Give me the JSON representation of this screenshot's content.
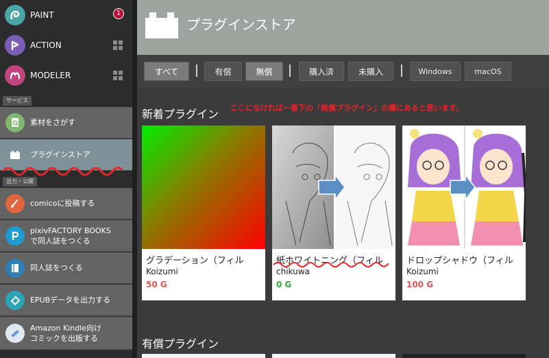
{
  "colors": {
    "sidebar_bg": "#2c2c2c",
    "service_item_bg": "#636363",
    "selected_item_bg": "#7f9199",
    "header_bg": "#9ea3a0",
    "annotation_red": "#e8232a",
    "price_paid": "#e05555",
    "price_free": "#2ea83a"
  },
  "apps": [
    {
      "label": "PAINT",
      "badge": "1",
      "icon": "paint-app-icon",
      "color": "#4aa6a6"
    },
    {
      "label": "ACTION",
      "icon": "action-app-icon",
      "color": "#7b5db3"
    },
    {
      "label": "MODELER",
      "icon": "modeler-app-icon",
      "color": "#c0447d"
    }
  ],
  "sections": {
    "service": "サービス",
    "output": "出力・公開"
  },
  "service_items": [
    {
      "lines": [
        "素材をさがす"
      ],
      "icon": "material-search-icon"
    },
    {
      "lines": [
        "プラグインストア"
      ],
      "icon": "plugin-store-icon",
      "selected": true
    }
  ],
  "output_items": [
    {
      "lines": [
        "comicoに投稿する"
      ],
      "icon": "comico-icon"
    },
    {
      "lines": [
        "pixivFACTORY BOOKS",
        "で同人誌をつくる"
      ],
      "icon": "pixiv-icon"
    },
    {
      "lines": [
        "同人誌をつくる"
      ],
      "icon": "book-icon"
    },
    {
      "lines": [
        "EPUBデータを出力する"
      ],
      "icon": "epub-icon"
    },
    {
      "lines": [
        "Amazon  Kindle向け",
        "コミックを出版する"
      ],
      "icon": "kindle-icon"
    }
  ],
  "header": {
    "title": "プラグインストア"
  },
  "filters": {
    "all": "すべて",
    "paid": "有償",
    "free": "無償",
    "purchased": "購入済",
    "not_purchased": "未購入",
    "windows": "Windows",
    "macos": "macOS"
  },
  "sections_main": {
    "new": "新着プラグイン",
    "paid": "有償プラグイン"
  },
  "annotation": "ここになければ一番下の「無償プラグイン」の欄にあると思います。",
  "cards": [
    {
      "name": "グラデーション（フィル",
      "author": "Koizumi",
      "price": "50 G",
      "price_type": "paid"
    },
    {
      "name": "紙ホワイトニング（フィル",
      "author": "chikuwa",
      "price": "0 G",
      "price_type": "free"
    },
    {
      "name": "ドロップシャドウ（フィル",
      "author": "Koizumi",
      "price": "100 G",
      "price_type": "paid"
    }
  ]
}
